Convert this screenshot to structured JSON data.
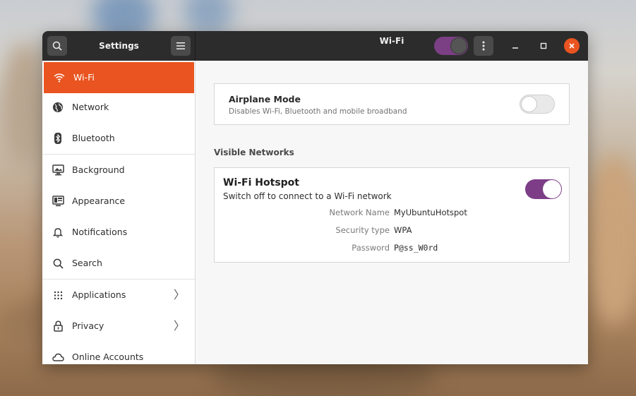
{
  "window": {
    "sidebar_title": "Settings",
    "main_title": "Wi-Fi",
    "wifi_switch_on": true,
    "accent_color": "#e95420",
    "switch_color": "#7d3e87"
  },
  "sidebar": {
    "items": [
      {
        "label": "Wi-Fi",
        "icon": "wifi-icon",
        "active": true
      },
      {
        "label": "Network",
        "icon": "network-globe-icon"
      },
      {
        "label": "Bluetooth",
        "icon": "bluetooth-icon"
      },
      {
        "label": "Background",
        "icon": "monitor-icon"
      },
      {
        "label": "Appearance",
        "icon": "appearance-icon"
      },
      {
        "label": "Notifications",
        "icon": "bell-icon"
      },
      {
        "label": "Search",
        "icon": "search-icon"
      },
      {
        "label": "Applications",
        "icon": "grid-icon",
        "has_chevron": true
      },
      {
        "label": "Privacy",
        "icon": "lock-icon",
        "has_chevron": true
      },
      {
        "label": "Online Accounts",
        "icon": "cloud-icon"
      }
    ]
  },
  "main": {
    "airplane_mode": {
      "title": "Airplane Mode",
      "subtitle": "Disables Wi-Fi, Bluetooth and mobile broadband",
      "enabled": false
    },
    "visible_networks_title": "Visible Networks",
    "hotspot": {
      "title": "Wi-Fi Hotspot",
      "subtitle": "Switch off to connect to a Wi-Fi network",
      "enabled": true,
      "fields": [
        {
          "label": "Network Name",
          "value": "MyUbuntuHotspot"
        },
        {
          "label": "Security type",
          "value": "WPA"
        },
        {
          "label": "Password",
          "value": "P@ss_W0rd"
        }
      ]
    }
  }
}
